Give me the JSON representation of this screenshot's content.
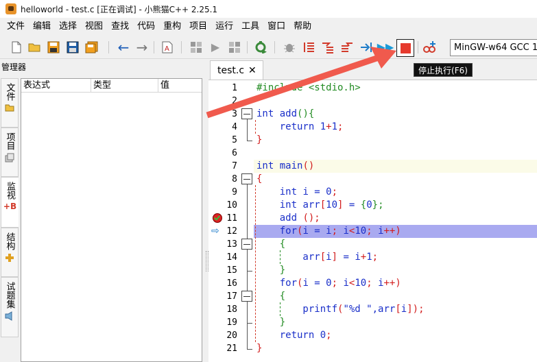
{
  "window": {
    "title": "helloworld - test.c [正在调试] - 小熊猫C++ 2.25.1"
  },
  "menu": [
    "文件",
    "编辑",
    "选择",
    "视图",
    "查找",
    "代码",
    "重构",
    "项目",
    "运行",
    "工具",
    "窗口",
    "帮助"
  ],
  "toolbar": {
    "icons": [
      "new-file-icon",
      "open-folder-icon",
      "save-icon",
      "save-as-icon",
      "save-all-icon",
      "back-arrow-icon",
      "forward-arrow-icon",
      "code-format-icon",
      "compile-icon",
      "run-icon",
      "compile-run-icon",
      "rebuild-icon",
      "debug-icon",
      "step-over-icon",
      "step-into-icon",
      "step-out-icon",
      "run-to-cursor-icon",
      "continue-icon",
      "stop-icon",
      "add-watch-icon"
    ],
    "stop_tooltip": "停止执行(F6)",
    "compiler": "MinGW-w64 GCC 1"
  },
  "left_panel": {
    "title": "管理器",
    "tabs": [
      {
        "label": "文件",
        "icon": "folder-icon"
      },
      {
        "label": "项目",
        "icon": "project-icon"
      },
      {
        "label": "监视",
        "icon": "watch-icon"
      },
      {
        "label": "结构",
        "icon": "structure-icon"
      },
      {
        "label": "试题集",
        "icon": "problem-set-icon"
      }
    ],
    "watch_columns": [
      "表达式",
      "类型",
      "值"
    ]
  },
  "editor": {
    "tab_name": "test.c",
    "current_line": 12,
    "breakpoint_line": 11,
    "lines": [
      {
        "no": "1",
        "segments": [
          {
            "t": "#include <stdio.h>",
            "c": "pre"
          }
        ]
      },
      {
        "no": "2",
        "segments": []
      },
      {
        "no": "3",
        "segments": [
          {
            "t": "int",
            "c": "kw"
          },
          {
            "t": " add",
            "c": "fn"
          },
          {
            "t": "(){",
            "c": "brc"
          }
        ]
      },
      {
        "no": "4",
        "segments": [
          {
            "t": "    return",
            "c": "kw"
          },
          {
            "t": " 1",
            "c": "num"
          },
          {
            "t": "+",
            "c": "op"
          },
          {
            "t": "1",
            "c": "num"
          },
          {
            "t": ";",
            "c": "op"
          }
        ]
      },
      {
        "no": "5",
        "segments": [
          {
            "t": "}",
            "c": "brk"
          }
        ]
      },
      {
        "no": "6",
        "segments": []
      },
      {
        "no": "7",
        "segments": [
          {
            "t": "int",
            "c": "kw"
          },
          {
            "t": " main",
            "c": "fn"
          },
          {
            "t": "()",
            "c": "brk"
          }
        ]
      },
      {
        "no": "8",
        "segments": [
          {
            "t": "{",
            "c": "brk"
          }
        ]
      },
      {
        "no": "9",
        "segments": [
          {
            "t": "    int",
            "c": "kw"
          },
          {
            "t": " i = ",
            "c": "fn"
          },
          {
            "t": "0",
            "c": "num"
          },
          {
            "t": ";",
            "c": "op"
          }
        ]
      },
      {
        "no": "10",
        "segments": [
          {
            "t": "    int",
            "c": "kw"
          },
          {
            "t": " arr",
            "c": "fn"
          },
          {
            "t": "[",
            "c": "brk"
          },
          {
            "t": "10",
            "c": "num"
          },
          {
            "t": "]",
            "c": "brk"
          },
          {
            "t": " = ",
            "c": "fn"
          },
          {
            "t": "{",
            "c": "brc"
          },
          {
            "t": "0",
            "c": "num"
          },
          {
            "t": "};",
            "c": "brc"
          }
        ]
      },
      {
        "no": "11",
        "segments": [
          {
            "t": "    add ",
            "c": "fn"
          },
          {
            "t": "();",
            "c": "brk"
          }
        ]
      },
      {
        "no": "12",
        "segments": [
          {
            "t": "    for",
            "c": "kw"
          },
          {
            "t": "(",
            "c": "brk"
          },
          {
            "t": "i = i",
            "c": "fn"
          },
          {
            "t": ";",
            "c": "op"
          },
          {
            "t": " i",
            "c": "fn"
          },
          {
            "t": "<",
            "c": "op"
          },
          {
            "t": "10",
            "c": "num"
          },
          {
            "t": ";",
            "c": "op"
          },
          {
            "t": " i",
            "c": "fn"
          },
          {
            "t": "++",
            "c": "op"
          },
          {
            "t": ")",
            "c": "brk"
          }
        ]
      },
      {
        "no": "13",
        "segments": [
          {
            "t": "    {",
            "c": "brc"
          }
        ]
      },
      {
        "no": "14",
        "segments": [
          {
            "t": "        arr",
            "c": "fn"
          },
          {
            "t": "[",
            "c": "brk"
          },
          {
            "t": "i",
            "c": "fn"
          },
          {
            "t": "]",
            "c": "brk"
          },
          {
            "t": " = i",
            "c": "fn"
          },
          {
            "t": "+",
            "c": "op"
          },
          {
            "t": "1",
            "c": "num"
          },
          {
            "t": ";",
            "c": "op"
          }
        ]
      },
      {
        "no": "15",
        "segments": [
          {
            "t": "    }",
            "c": "brc"
          }
        ]
      },
      {
        "no": "16",
        "segments": [
          {
            "t": "    for",
            "c": "kw"
          },
          {
            "t": "(",
            "c": "brk"
          },
          {
            "t": "i = ",
            "c": "fn"
          },
          {
            "t": "0",
            "c": "num"
          },
          {
            "t": ";",
            "c": "op"
          },
          {
            "t": " i",
            "c": "fn"
          },
          {
            "t": "<",
            "c": "op"
          },
          {
            "t": "10",
            "c": "num"
          },
          {
            "t": ";",
            "c": "op"
          },
          {
            "t": " i",
            "c": "fn"
          },
          {
            "t": "++",
            "c": "op"
          },
          {
            "t": ")",
            "c": "brk"
          }
        ]
      },
      {
        "no": "17",
        "segments": [
          {
            "t": "    {",
            "c": "brc"
          }
        ]
      },
      {
        "no": "18",
        "segments": [
          {
            "t": "        printf",
            "c": "fn"
          },
          {
            "t": "(",
            "c": "brk"
          },
          {
            "t": "\"%d \"",
            "c": "str"
          },
          {
            "t": ",arr",
            "c": "fn"
          },
          {
            "t": "[",
            "c": "brk"
          },
          {
            "t": "i",
            "c": "fn"
          },
          {
            "t": "]",
            "c": "brk"
          },
          {
            "t": ");",
            "c": "brk"
          }
        ]
      },
      {
        "no": "19",
        "segments": [
          {
            "t": "    }",
            "c": "brc"
          }
        ]
      },
      {
        "no": "20",
        "segments": [
          {
            "t": "    return",
            "c": "kw"
          },
          {
            "t": " 0",
            "c": "num"
          },
          {
            "t": ";",
            "c": "op"
          }
        ]
      },
      {
        "no": "21",
        "segments": [
          {
            "t": "}",
            "c": "brk"
          }
        ]
      }
    ]
  },
  "colors": {
    "current_line_highlight": "#a9aaf0",
    "cursor_line": "#fbfbe8",
    "annotation_arrow": "#f05a4d",
    "stop_button": "#e63a2e",
    "keyword": "#1a2fc9",
    "bracket": "#d21b1b",
    "brace": "#228b22"
  }
}
